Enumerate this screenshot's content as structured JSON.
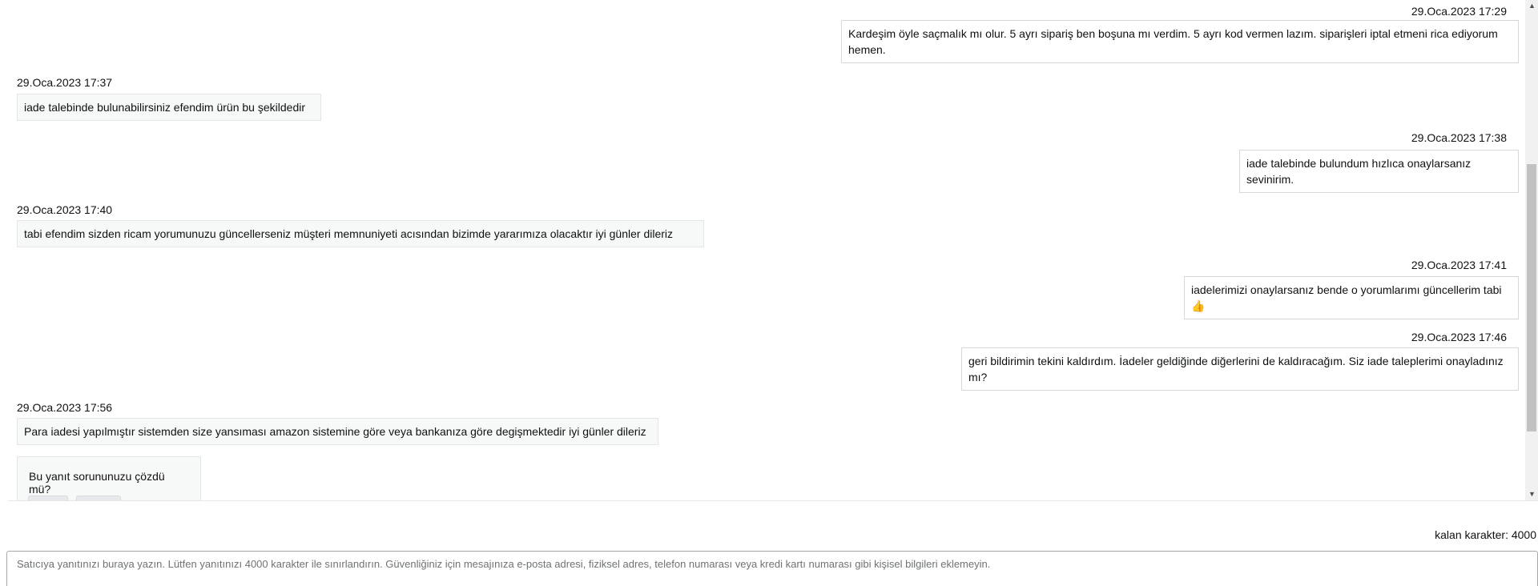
{
  "messages": [
    {
      "side": "buyer",
      "timestamp": "29.Oca.2023 17:29",
      "text": "Kardeşim öyle saçmalık mı olur. 5 ayrı sipariş ben boşuna mı verdim. 5 ayrı kod vermen lazım. siparişleri iptal etmeni rica ediyorum hemen."
    },
    {
      "side": "seller",
      "timestamp": "29.Oca.2023 17:37",
      "text": "iade talebinde bulunabilirsiniz efendim ürün bu şekildedir"
    },
    {
      "side": "buyer",
      "timestamp": "29.Oca.2023 17:38",
      "text": "iade talebinde bulundum hızlıca onaylarsanız sevinirim."
    },
    {
      "side": "seller",
      "timestamp": "29.Oca.2023 17:40",
      "text": "tabi efendim sizden ricam yorumunuzu güncellerseniz müşteri memnuniyeti acısından bizimde yararımıza olacaktır iyi günler dileriz"
    },
    {
      "side": "buyer",
      "timestamp": "29.Oca.2023 17:41",
      "text": "iadelerimizi onaylarsanız bende o yorumlarımı güncellerim tabi 👍"
    },
    {
      "side": "buyer",
      "timestamp": "29.Oca.2023 17:46",
      "text": "geri bildirimin tekini kaldırdım. İadeler geldiğinde diğerlerini de kaldıracağım. Siz iade taleplerimi onayladınız mı?"
    },
    {
      "side": "seller",
      "timestamp": "29.Oca.2023 17:56",
      "text": "Para iadesi yapılmıştır sistemden size yansıması amazon sistemine göre veya bankanıza göre degişmektedir iyi günler dileriz"
    }
  ],
  "feedback": {
    "question": "Bu yanıt sorununuzu çözdü mü?",
    "yes_label": "",
    "no_label": ""
  },
  "reply": {
    "counter_label": "kalan karakter: 4000",
    "placeholder": "Satıcıya yanıtınızı buraya yazın. Lütfen yanıtınızı 4000 karakter ile sınırlandırın. Güvenliğiniz için mesajınıza e-posta adresi, fiziksel adres, telefon numarası veya kredi kartı numarası gibi kişisel bilgileri eklemeyin."
  },
  "icons": {
    "scroll_up": "scroll-up-arrow-icon",
    "scroll_down": "scroll-down-arrow-icon"
  }
}
